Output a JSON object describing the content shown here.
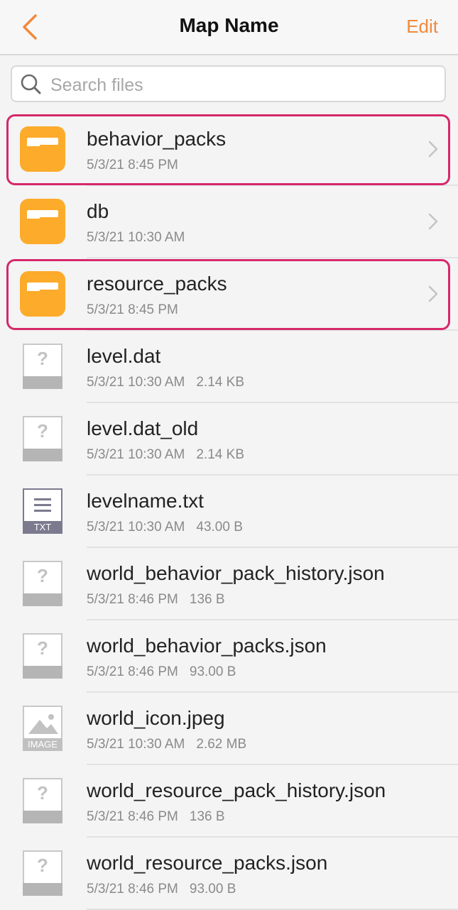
{
  "header": {
    "title": "Map Name",
    "edit_label": "Edit",
    "back_icon": "chevron-left-icon"
  },
  "search": {
    "placeholder": "Search files",
    "value": ""
  },
  "colors": {
    "accent": "#f08a3c",
    "folder": "#fdab2b",
    "highlight": "#d6286a"
  },
  "files": [
    {
      "name": "behavior_packs",
      "date": "5/3/21 8:45 PM",
      "size": "",
      "type": "folder",
      "highlighted": true
    },
    {
      "name": "db",
      "date": "5/3/21 10:30 AM",
      "size": "",
      "type": "folder",
      "highlighted": false
    },
    {
      "name": "resource_packs",
      "date": "5/3/21 8:45 PM",
      "size": "",
      "type": "folder",
      "highlighted": true
    },
    {
      "name": "level.dat",
      "date": "5/3/21 10:30 AM",
      "size": "2.14 KB",
      "type": "unknown",
      "highlighted": false
    },
    {
      "name": "level.dat_old",
      "date": "5/3/21 10:30 AM",
      "size": "2.14 KB",
      "type": "unknown",
      "highlighted": false
    },
    {
      "name": "levelname.txt",
      "date": "5/3/21 10:30 AM",
      "size": "43.00 B",
      "type": "txt",
      "badge": "TXT",
      "highlighted": false
    },
    {
      "name": "world_behavior_pack_history.json",
      "date": "5/3/21 8:46 PM",
      "size": "136 B",
      "type": "unknown",
      "highlighted": false
    },
    {
      "name": "world_behavior_packs.json",
      "date": "5/3/21 8:46 PM",
      "size": "93.00 B",
      "type": "unknown",
      "highlighted": false
    },
    {
      "name": "world_icon.jpeg",
      "date": "5/3/21 10:30 AM",
      "size": "2.62 MB",
      "type": "image",
      "badge": "IMAGE",
      "highlighted": false
    },
    {
      "name": "world_resource_pack_history.json",
      "date": "5/3/21 8:46 PM",
      "size": "136 B",
      "type": "unknown",
      "highlighted": false
    },
    {
      "name": "world_resource_packs.json",
      "date": "5/3/21 8:46 PM",
      "size": "93.00 B",
      "type": "unknown",
      "highlighted": false
    }
  ]
}
